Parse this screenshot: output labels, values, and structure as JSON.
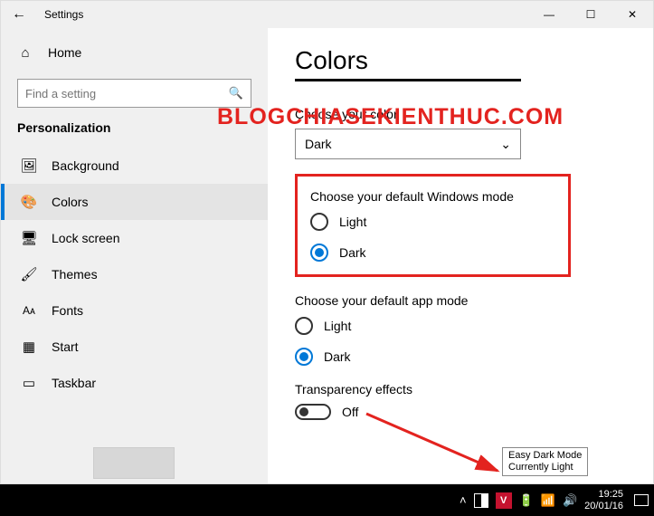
{
  "titlebar": {
    "title": "Settings"
  },
  "sidebar": {
    "home": "Home",
    "search_placeholder": "Find a setting",
    "category": "Personalization",
    "items": [
      {
        "label": "Background"
      },
      {
        "label": "Colors"
      },
      {
        "label": "Lock screen"
      },
      {
        "label": "Themes"
      },
      {
        "label": "Fonts"
      },
      {
        "label": "Start"
      },
      {
        "label": "Taskbar"
      }
    ]
  },
  "content": {
    "page_title": "Colors",
    "choose_color_label": "Choose your color",
    "choose_color_value": "Dark",
    "windows_mode": {
      "label": "Choose your default Windows mode",
      "options": [
        "Light",
        "Dark"
      ],
      "selected": "Dark"
    },
    "app_mode": {
      "label": "Choose your default app mode",
      "options": [
        "Light",
        "Dark"
      ],
      "selected": "Dark"
    },
    "transparency": {
      "label": "Transparency effects",
      "value": "Off"
    }
  },
  "watermark": "BLOGCHIASEKIENTHUC.COM",
  "tooltip": {
    "line1": "Easy Dark Mode",
    "line2": "Currently Light"
  },
  "taskbar": {
    "time": "19:25",
    "date": "20/01/16"
  }
}
